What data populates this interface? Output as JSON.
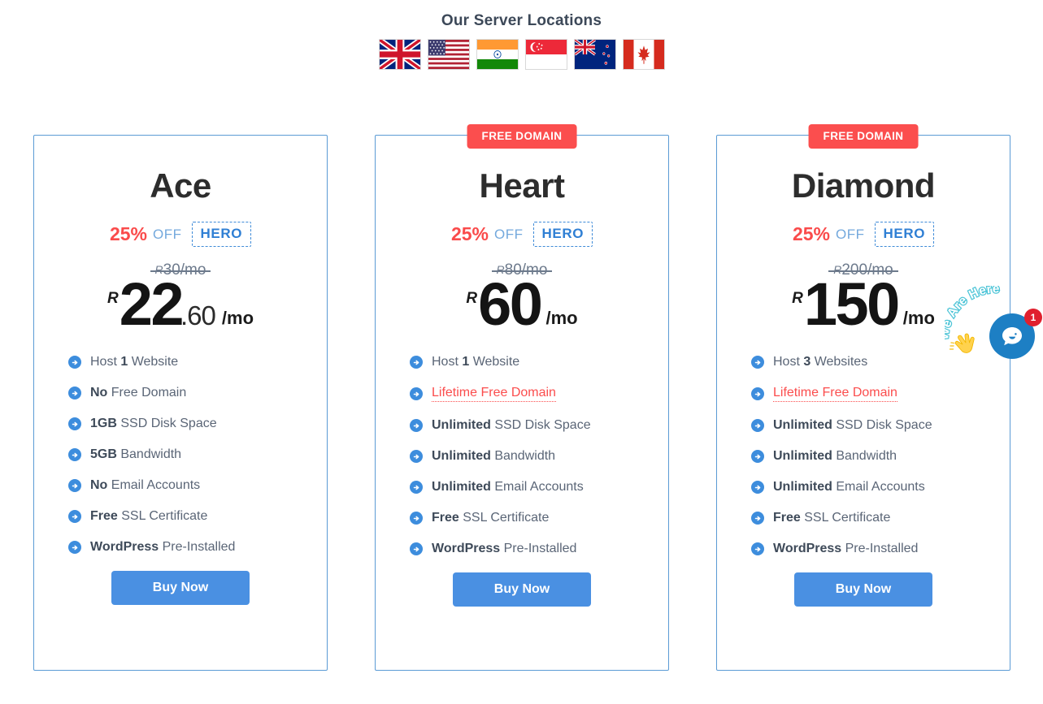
{
  "header": {
    "title": "Our Server Locations",
    "flags": [
      {
        "name": "flag-united-kingdom",
        "label": "United Kingdom"
      },
      {
        "name": "flag-united-states",
        "label": "United States"
      },
      {
        "name": "flag-india",
        "label": "India"
      },
      {
        "name": "flag-singapore",
        "label": "Singapore"
      },
      {
        "name": "flag-new-zealand",
        "label": "New Zealand"
      },
      {
        "name": "flag-canada",
        "label": "Canada"
      }
    ]
  },
  "colors": {
    "card_border": "#5b9bd5",
    "ribbon_red": "#fb4e4e",
    "promo_red": "#fa4b4b",
    "promo_blue": "#74a9dd",
    "coupon_blue": "#2f7fd4",
    "bullet_blue": "#3d8ddd",
    "buy_blue": "#4a90e2",
    "highlight_red": "#fb4d4d",
    "chat_blue": "#1d7fc4",
    "badge_red": "#e0202e"
  },
  "plans": [
    {
      "id": "ace",
      "ribbon": null,
      "name": "Ace",
      "promo_percent": "25%",
      "promo_off": "OFF",
      "promo_code": "HERO",
      "old_price_currency": "R",
      "old_price": "30",
      "old_price_period": "/mo",
      "currency": "R",
      "price_main": "22",
      "price_decimal": ".60",
      "price_period": "/mo",
      "features": [
        {
          "bold": "",
          "text": "Host ",
          "bold_mid": "1",
          "tail": " Website",
          "highlight": false
        },
        {
          "bold": "No",
          "tail": " Free Domain",
          "highlight": false
        },
        {
          "bold": "1GB",
          "tail": " SSD Disk Space",
          "highlight": false
        },
        {
          "bold": "5GB",
          "tail": " Bandwidth",
          "highlight": false
        },
        {
          "bold": "No",
          "tail": " Email Accounts",
          "highlight": false
        },
        {
          "bold": "Free",
          "tail": " SSL Certificate",
          "highlight": false
        },
        {
          "bold": "WordPress",
          "tail": " Pre-Installed",
          "highlight": false
        }
      ],
      "button_label": "Buy Now"
    },
    {
      "id": "heart",
      "ribbon": "FREE DOMAIN",
      "name": "Heart",
      "promo_percent": "25%",
      "promo_off": "OFF",
      "promo_code": "HERO",
      "old_price_currency": "R",
      "old_price": "80",
      "old_price_period": "/mo",
      "currency": "R",
      "price_main": "60",
      "price_decimal": "",
      "price_period": "/mo",
      "features": [
        {
          "bold": "",
          "text": "Host ",
          "bold_mid": "1",
          "tail": " Website",
          "highlight": false
        },
        {
          "bold": "",
          "tail": "Lifetime Free Domain",
          "highlight": true
        },
        {
          "bold": "Unlimited",
          "tail": " SSD Disk Space",
          "highlight": false
        },
        {
          "bold": "Unlimited",
          "tail": " Bandwidth",
          "highlight": false
        },
        {
          "bold": "Unlimited",
          "tail": " Email Accounts",
          "highlight": false
        },
        {
          "bold": "Free",
          "tail": " SSL Certificate",
          "highlight": false
        },
        {
          "bold": "WordPress",
          "tail": " Pre-Installed",
          "highlight": false
        }
      ],
      "button_label": "Buy Now"
    },
    {
      "id": "diamond",
      "ribbon": "FREE DOMAIN",
      "name": "Diamond",
      "promo_percent": "25%",
      "promo_off": "OFF",
      "promo_code": "HERO",
      "old_price_currency": "R",
      "old_price": "200",
      "old_price_period": "/mo",
      "currency": "R",
      "price_main": "150",
      "price_decimal": "",
      "price_period": "/mo",
      "features": [
        {
          "bold": "",
          "text": "Host ",
          "bold_mid": "3",
          "tail": " Websites",
          "highlight": false
        },
        {
          "bold": "",
          "tail": "Lifetime Free Domain",
          "highlight": true
        },
        {
          "bold": "Unlimited",
          "tail": " SSD Disk Space",
          "highlight": false
        },
        {
          "bold": "Unlimited",
          "tail": " Bandwidth",
          "highlight": false
        },
        {
          "bold": "Unlimited",
          "tail": " Email Accounts",
          "highlight": false
        },
        {
          "bold": "Free",
          "tail": " SSL Certificate",
          "highlight": false
        },
        {
          "bold": "WordPress",
          "tail": " Pre-Installed",
          "highlight": false
        }
      ],
      "button_label": "Buy Now"
    }
  ],
  "chat_widget": {
    "arc_text": "We Are Here",
    "badge_count": "1"
  }
}
